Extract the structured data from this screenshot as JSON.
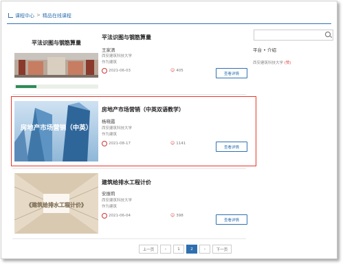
{
  "breadcrumb": {
    "home": "课程中心",
    "separator": ">",
    "current": "精品在线课程"
  },
  "search": {
    "placeholder": ""
  },
  "sidebar": {
    "title": "平台 • 介绍",
    "subtitle": "西安建筑科技大学",
    "tag": "(赞)"
  },
  "courses": [
    {
      "title": "平法识图与钢筋算量",
      "teacher": "王家清",
      "school": "西安建筑科技大学",
      "category": "作为建筑",
      "date": "2021-06-03",
      "count": "405",
      "button": "查看详情",
      "thumb_title": "平法识图与钢筋算量"
    },
    {
      "title": "房地产市场营销（中英双语教学）",
      "teacher": "杨晓霞",
      "school": "西安建筑科技大学",
      "category": "作为建筑",
      "date": "2021-08-17",
      "count": "1141",
      "button": "查看详情",
      "thumb_title": "房地产市场营销（中英）"
    },
    {
      "title": "建筑给排水工程计价",
      "teacher": "安振莉",
      "school": "西安建筑科技大学",
      "category": "作为建筑",
      "date": "2021-06-04",
      "count": "398",
      "button": "查看详情",
      "thumb_title": "《建筑给排水工程计价》"
    }
  ],
  "pagination": {
    "first": "上一页",
    "prev": "‹",
    "pages": [
      "1",
      "2"
    ],
    "active": "2",
    "next": "›",
    "last": "下一页"
  },
  "colors": {
    "accent": "#2f6fb0",
    "highlight": "#e8342a"
  }
}
